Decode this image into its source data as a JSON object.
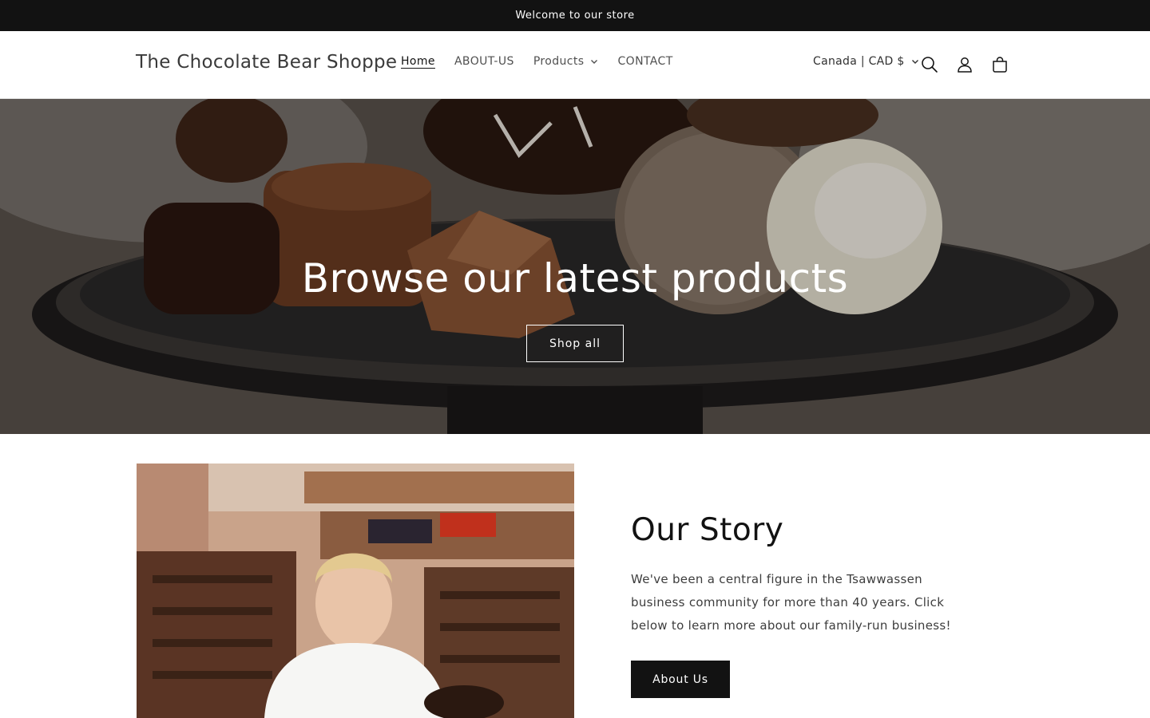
{
  "announcement": {
    "text": "Welcome to our store"
  },
  "header": {
    "logo": "The Chocolate Bear Shoppe",
    "nav": [
      {
        "label": "Home",
        "active": true
      },
      {
        "label": "ABOUT-US"
      },
      {
        "label": "Products",
        "has_dropdown": true
      },
      {
        "label": "CONTACT"
      }
    ],
    "currency": "Canada | CAD $",
    "icons": [
      "search-icon",
      "account-icon",
      "cart-icon"
    ]
  },
  "hero": {
    "title": "Browse our latest products",
    "button_label": "Shop all"
  },
  "story": {
    "title": "Our Story",
    "text": "We've been a central figure in the Tsawwassen business community for more than 40 years. Click below to learn more about our family-run business!",
    "button_label": "About Us"
  },
  "colors": {
    "announcement_bg": "#121212",
    "primary_button_bg": "#121212",
    "text": "#121212",
    "white": "#ffffff"
  }
}
